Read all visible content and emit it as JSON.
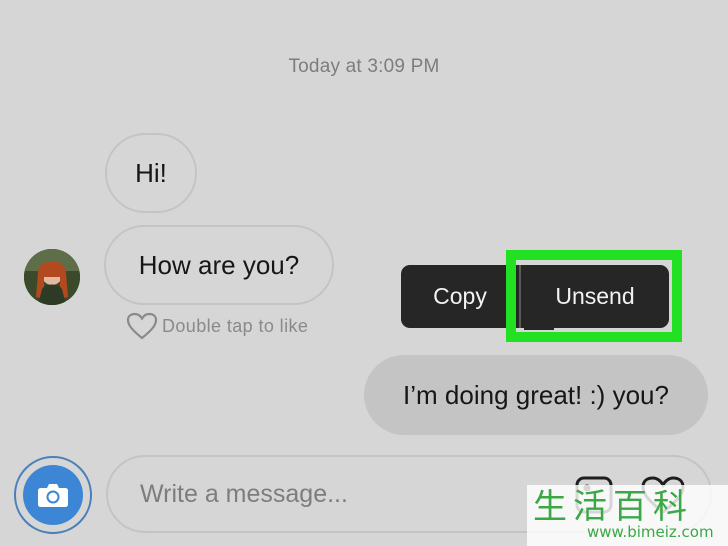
{
  "conversation": {
    "timestamp": "Today at 3:09 PM",
    "incoming": [
      {
        "text": "Hi!"
      },
      {
        "text": "How are you?"
      }
    ],
    "like_hint": "Double tap to like",
    "outgoing": [
      {
        "text": "I’m doing great! :) you?"
      }
    ]
  },
  "context_menu": {
    "copy_label": "Copy",
    "unsend_label": "Unsend",
    "highlight_color": "#22e022"
  },
  "composer": {
    "placeholder": "Write a message...",
    "camera_icon": "camera-icon",
    "image_icon": "image-icon",
    "like_icon": "heart-icon"
  },
  "watermark": {
    "chars": "生活百科",
    "url": "www.bimeiz.com"
  },
  "colors": {
    "background": "#d6d6d6",
    "popup_bg": "#262626",
    "camera_blue": "#3d86d6",
    "outgoing_bubble": "#c4c4c4"
  }
}
